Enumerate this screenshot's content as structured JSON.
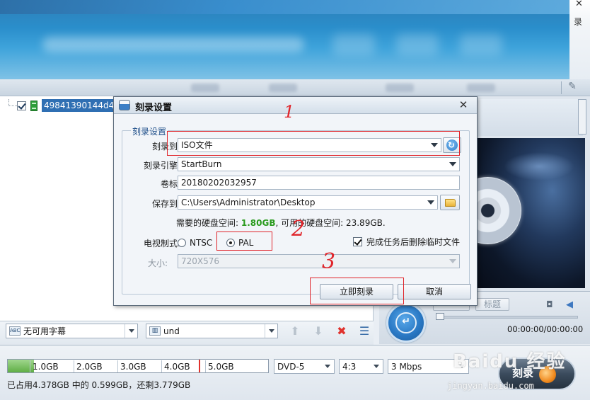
{
  "window": {
    "close_glyph": "✕",
    "right_label": "录",
    "edit_glyph": "✎"
  },
  "file_tree": {
    "item_label": "49841390144d4"
  },
  "dialog": {
    "title": "刻录设置",
    "close_glyph": "✕",
    "group_title": "刻录设置",
    "burn_to_label": "刻录到:",
    "burn_to_value": "ISO文件",
    "engine_label": "刻录引擎:",
    "engine_value": "StartBurn",
    "volume_label": "卷标:",
    "volume_value": "20180202032957",
    "save_to_label": "保存到:",
    "save_to_value": "C:\\Users\\Administrator\\Desktop",
    "space_required_prefix": "需要的硬盘空间: ",
    "space_required_value": "1.80GB",
    "space_available_prefix": ", 可用的硬盘空间: ",
    "space_available_value": "23.89GB.",
    "tv_format_label": "电视制式:",
    "ntsc_label": "NTSC",
    "pal_label": "PAL",
    "delete_temp_label": "完成任务后删除临时文件",
    "size_label": "大小:",
    "size_value": "720X576",
    "burn_now_label": "立即刻录",
    "cancel_label": "取消"
  },
  "annotations": {
    "one": "1",
    "two": "2",
    "three": "3"
  },
  "player": {
    "title_btn": "标题",
    "timecode": "00:00:00/00:00:00"
  },
  "subtitle_row": {
    "subtitle_value": "无可用字幕",
    "subtitle_icon_text": "ABC",
    "audio_value": "und"
  },
  "disk": {
    "used_gb": 4.378,
    "capacity_gb": 4.7,
    "ticks": [
      "1.0GB",
      "2.0GB",
      "3.0GB",
      "4.0GB",
      "5.0GB"
    ],
    "summary": "已占用4.378GB 中的 0.599GB，还剩3.779GB",
    "disc_type": "DVD-5",
    "aspect": "4:3",
    "bitrate": "3 Mbps"
  },
  "burn_button": {
    "label": "刻录"
  },
  "watermark": {
    "brand": "Baidu 经验",
    "url": "jingyan.baidu.com"
  }
}
